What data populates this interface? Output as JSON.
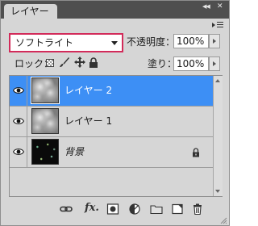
{
  "panel": {
    "tab_label": "レイヤー",
    "collapse_glyph": "◀◀",
    "close_glyph": "✕"
  },
  "blend": {
    "mode": "ソフトライト",
    "highlight_color": "#d22b5a"
  },
  "opacity": {
    "label": "不透明度：",
    "value": "100%"
  },
  "lock": {
    "label": "ロック：",
    "icons": [
      "lock-transparent-pixels-icon",
      "lock-image-pixels-icon",
      "lock-position-icon",
      "lock-all-icon"
    ]
  },
  "fill": {
    "label": "塗り：",
    "value": "100%"
  },
  "layers": [
    {
      "name": "レイヤー 2",
      "selected": true,
      "visible": true,
      "thumbnail": "clouds",
      "locked": false
    },
    {
      "name": "レイヤー 1",
      "selected": false,
      "visible": true,
      "thumbnail": "clouds",
      "locked": false
    },
    {
      "name": "背景",
      "selected": false,
      "visible": true,
      "thumbnail": "dark-speckle",
      "locked": true
    }
  ],
  "selection_color": "#3d8ff5",
  "toolbar": {
    "buttons": [
      "link-layers-icon",
      "fx-icon",
      "layer-mask-icon",
      "adjustment-layer-icon",
      "new-group-icon",
      "new-layer-icon",
      "trash-icon"
    ],
    "fx_label": "fx."
  }
}
